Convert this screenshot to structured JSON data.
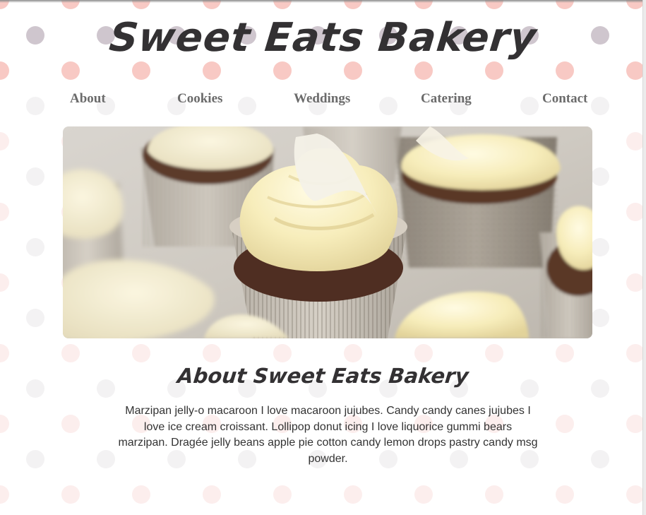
{
  "header": {
    "title": "Sweet Eats Bakery"
  },
  "nav": {
    "items": [
      {
        "label": "About"
      },
      {
        "label": "Cookies"
      },
      {
        "label": "Weddings"
      },
      {
        "label": "Catering"
      },
      {
        "label": "Contact"
      }
    ]
  },
  "hero": {
    "image": "cupcakes-with-cream-frosting-photo"
  },
  "about": {
    "title": "About Sweet Eats Bakery",
    "body": "Marzipan jelly-o macaroon I love macaroon jujubes. Candy candy canes jujubes I love ice cream croissant. Lollipop donut icing I love liquorice gummi bears marzipan. Dragée jelly beans apple pie cotton candy lemon drops pastry candy msg powder."
  },
  "colors": {
    "title_text": "#333133",
    "nav_text": "#6b6b6b",
    "body_text": "#333333",
    "dot_pink": "#f8c9c4",
    "dot_mauve": "#cfc6ce",
    "dot_grey": "#f3f2f3",
    "dot_faint_pink": "#fceeed"
  }
}
